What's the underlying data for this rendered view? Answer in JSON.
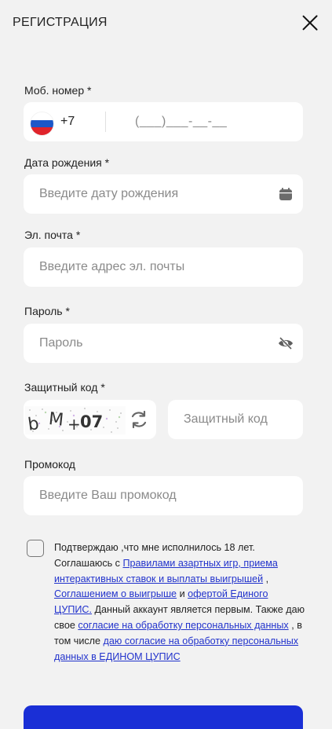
{
  "header": {
    "title": "РЕГИСТРАЦИЯ"
  },
  "phone": {
    "label": "Моб. номер *",
    "code": "+7",
    "mask": "(___)___-__-__"
  },
  "birthdate": {
    "label": "Дата рождения *",
    "placeholder": "Введите дату рождения",
    "icon": "calendar-icon"
  },
  "email": {
    "label": "Эл. почта *",
    "placeholder": "Введите адрес эл. почты"
  },
  "password": {
    "label": "Пароль *",
    "placeholder": "Пароль",
    "icon": "eye-off-icon"
  },
  "captcha": {
    "label": "Защитный код *",
    "placeholder": "Защитный код",
    "image_text": "bM+07",
    "refresh_icon": "refresh-icon"
  },
  "promo": {
    "label": "Промокод",
    "placeholder": "Введите Ваш промокод"
  },
  "agreement": {
    "text1": "Подтверждаю ,что мне исполнилось 18 лет. Соглашаюсь с",
    "link1": "Правилами азартных игр, приема интерактивных ставок и выплаты выигрышей",
    "text2": ",",
    "link2": "Соглашением о выигрыше",
    "text3": "и",
    "link3": "офертой Единого ЦУПИС.",
    "text4": "Данный аккаунт является первым. Также даю свое",
    "link4": "согласие на обработку персональных данных",
    "text5": ", в том числе",
    "link5": "даю согласие на обработку персональных данных в ЕДИНОМ ЦУПИС"
  },
  "colors": {
    "accent": "#1a2fd6",
    "link": "#2233cc",
    "background": "#f2f2f2"
  }
}
